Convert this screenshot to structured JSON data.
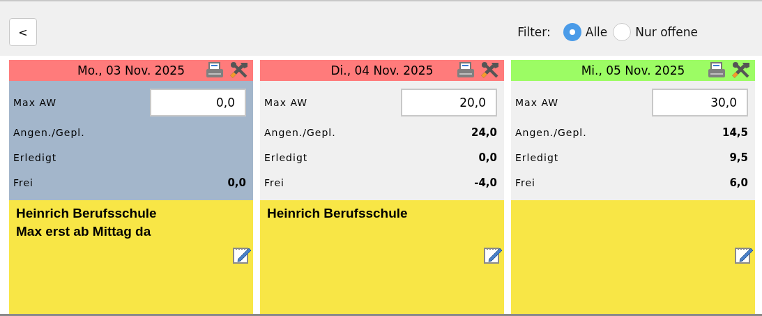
{
  "back_button": {
    "label": "<"
  },
  "filter": {
    "label": "Filter:",
    "options": [
      {
        "label": "Alle",
        "selected": true
      },
      {
        "label": "Nur offene",
        "selected": false
      }
    ]
  },
  "days": [
    {
      "date": "Mo., 03 Nov. 2025",
      "color": "#ff7b7b",
      "selected": true,
      "max_aw_label": "Max AW",
      "max_aw": "0,0",
      "stats": [
        {
          "label": "Angen./Gepl."
        },
        {
          "label": "Erledigt"
        },
        {
          "label": "Frei",
          "value": "0,0"
        }
      ],
      "note": "Heinrich Berufsschule\nMax erst ab Mittag da"
    },
    {
      "date": "Di., 04 Nov. 2025",
      "color": "#ff7b7b",
      "selected": false,
      "max_aw_label": "Max AW",
      "max_aw": "20,0",
      "stats": [
        {
          "label": "Angen./Gepl.",
          "value": "24,0"
        },
        {
          "label": "Erledigt",
          "value": "0,0"
        },
        {
          "label": "Frei",
          "value": "-4,0"
        }
      ],
      "note": "Heinrich Berufsschule"
    },
    {
      "date": "Mi., 05 Nov. 2025",
      "color": "#9cfc64",
      "selected": false,
      "max_aw_label": "Max AW",
      "max_aw": "30,0",
      "stats": [
        {
          "label": "Angen./Gepl.",
          "value": "14,5"
        },
        {
          "label": "Erledigt",
          "value": "9,5"
        },
        {
          "label": "Frei",
          "value": "6,0"
        }
      ]
    }
  ]
}
